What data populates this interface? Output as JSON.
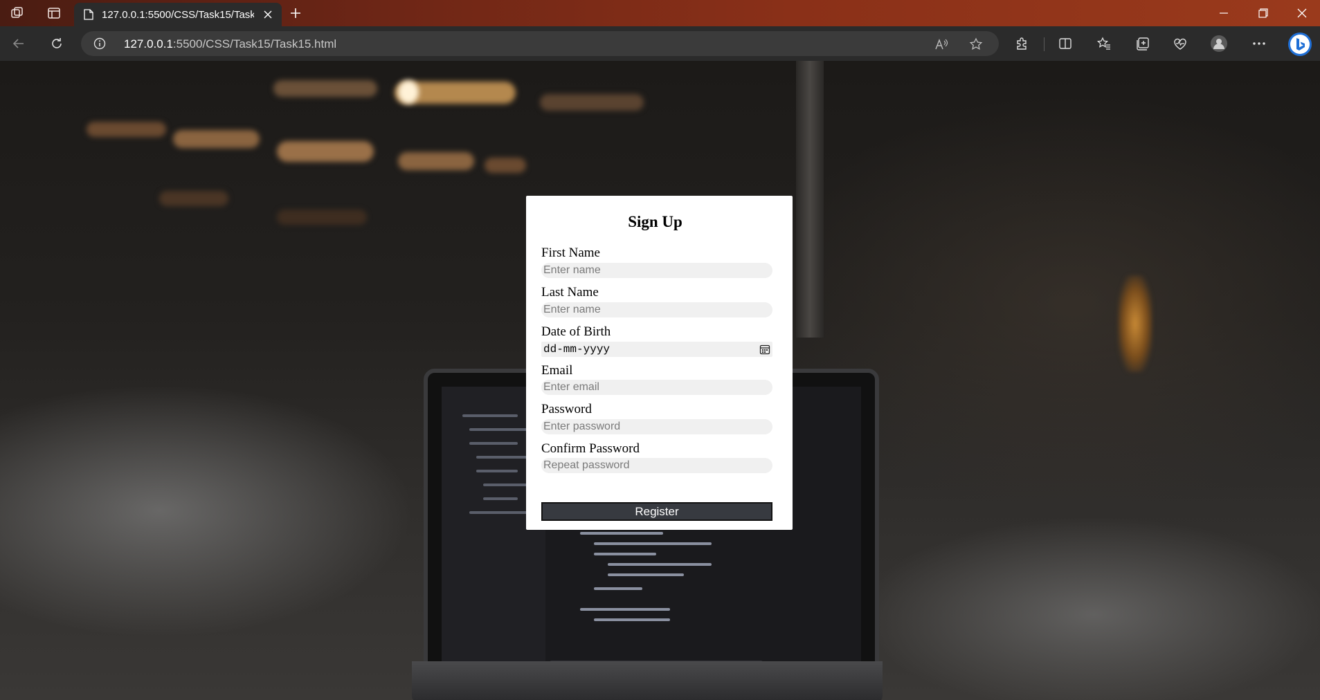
{
  "browser": {
    "tab_title": "127.0.0.1:5500/CSS/Task15/Task15.html",
    "url_host": "127.0.0.1",
    "url_rest": ":5500/CSS/Task15/Task15.html"
  },
  "form": {
    "title": "Sign Up",
    "fields": [
      {
        "label": "First Name",
        "placeholder": "Enter name"
      },
      {
        "label": "Last Name",
        "placeholder": "Enter name"
      },
      {
        "label": "Date of Birth",
        "placeholder": "dd-mm-yyyy"
      },
      {
        "label": "Email",
        "placeholder": "Enter email"
      },
      {
        "label": "Password",
        "placeholder": "Enter password"
      },
      {
        "label": "Confirm Password",
        "placeholder": "Repeat password"
      }
    ],
    "submit_label": "Register"
  },
  "colors": {
    "titlebar_accent": "#8a3018",
    "toolbar_bg": "#2b2b2b",
    "button_bg": "#373a40",
    "input_bg": "#f0f0f0",
    "bing_accent": "#1f6fd6"
  }
}
